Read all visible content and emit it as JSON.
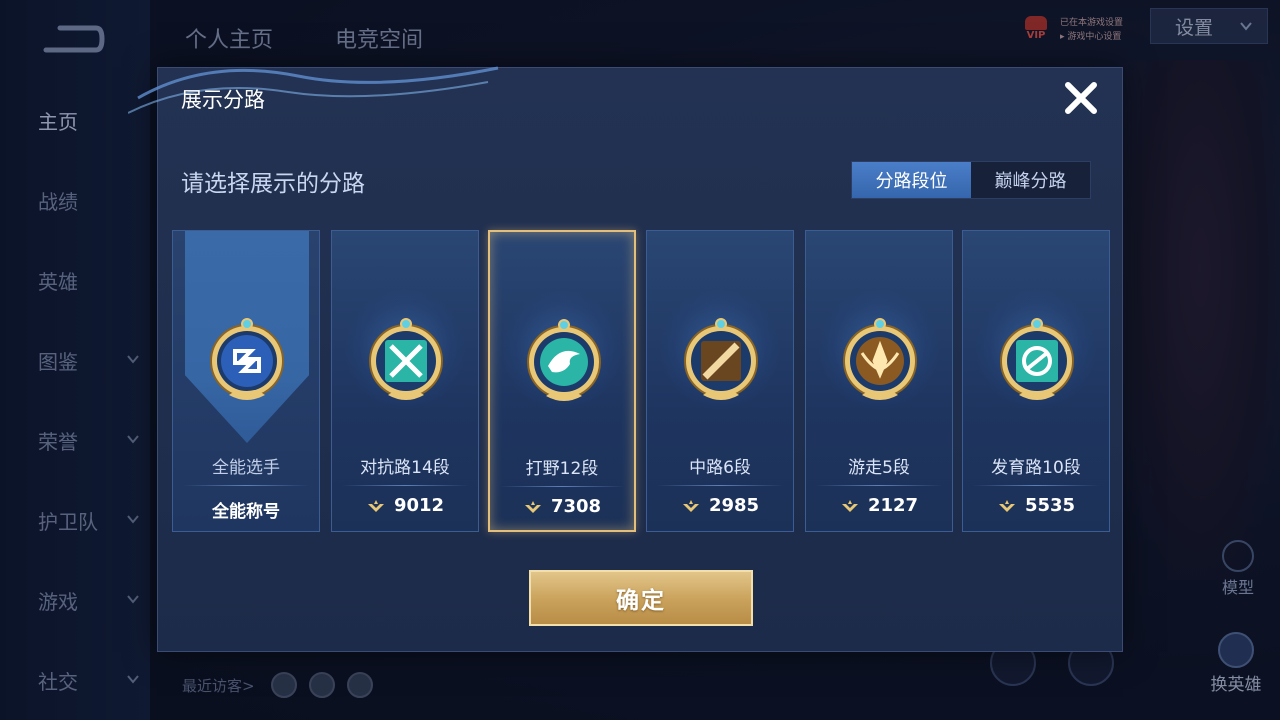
{
  "sidebar": {
    "items": [
      {
        "label": "主页",
        "has_chevron": false
      },
      {
        "label": "战绩",
        "has_chevron": false
      },
      {
        "label": "英雄",
        "has_chevron": false
      },
      {
        "label": "图鉴",
        "has_chevron": true
      },
      {
        "label": "荣誉",
        "has_chevron": true
      },
      {
        "label": "护卫队",
        "has_chevron": true
      },
      {
        "label": "游戏",
        "has_chevron": true
      },
      {
        "label": "社交",
        "has_chevron": true
      }
    ]
  },
  "top_tabs": [
    "个人主页",
    "电竞空间"
  ],
  "vip": {
    "badge": "VIP",
    "line1": "已在本游戏设置",
    "line2": "▸ 游戏中心设置"
  },
  "settings": {
    "label": "设置"
  },
  "right_buttons": {
    "model": "模型",
    "switch_hero": "换英雄"
  },
  "visitors": {
    "label": "最近访客>"
  },
  "dialog": {
    "title": "展示分路",
    "subtitle": "请选择展示的分路",
    "toggle": {
      "options": [
        "分路段位",
        "巅峰分路"
      ],
      "active_index": 0
    },
    "cards": [
      {
        "name": "全能选手",
        "score": "",
        "title": "全能称号",
        "kind": "allround",
        "selected": false
      },
      {
        "name": "对抗路14段",
        "score": "9012",
        "title": "",
        "kind": "clash",
        "selected": false
      },
      {
        "name": "打野12段",
        "score": "7308",
        "title": "",
        "kind": "jungle",
        "selected": true
      },
      {
        "name": "中路6段",
        "score": "2985",
        "title": "",
        "kind": "mid",
        "selected": false
      },
      {
        "name": "游走5段",
        "score": "2127",
        "title": "",
        "kind": "roam",
        "selected": false
      },
      {
        "name": "发育路10段",
        "score": "5535",
        "title": "",
        "kind": "farm",
        "selected": false
      }
    ],
    "confirm_label": "确定"
  },
  "colors": {
    "accent_blue": "#3566ad",
    "gold": "#c9a15a",
    "emblem_teal": "#2bb5a6",
    "emblem_gold": "#e8c777"
  }
}
